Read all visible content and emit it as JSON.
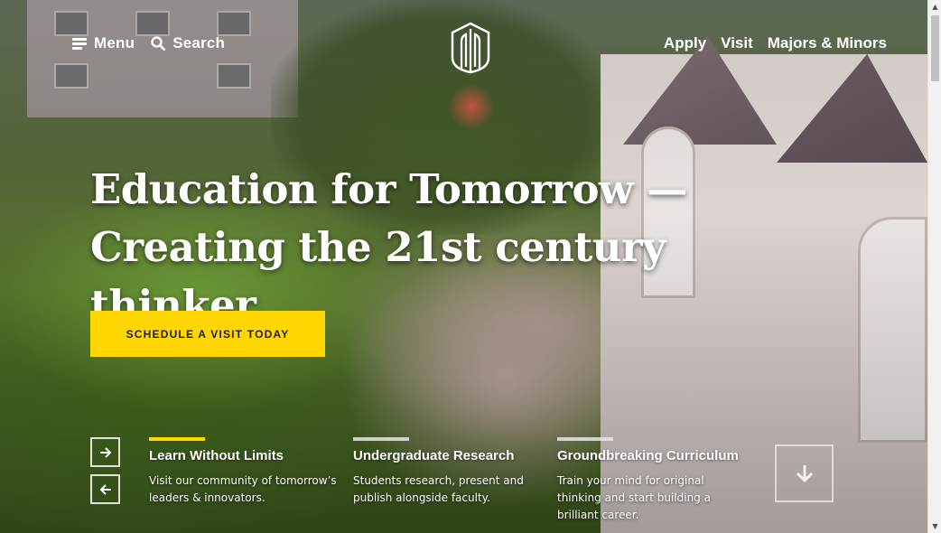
{
  "header": {
    "menu_label": "Menu",
    "search_label": "Search",
    "nav_links": [
      "Apply",
      "Visit",
      "Majors & Minors"
    ]
  },
  "hero": {
    "headline_line1": "Education for Tomorrow —",
    "headline_line2": "Creating the 21st century thinker.",
    "cta_label": "SCHEDULE A VISIT TODAY"
  },
  "features": [
    {
      "title": "Learn Without Limits",
      "text": "Visit our community of tomorrow’s leaders & innovators.",
      "active": true
    },
    {
      "title": "Undergraduate Research",
      "text": "Students research, present and publish alongside faculty.",
      "active": false
    },
    {
      "title": "Groundbreaking Curriculum",
      "text": "Train your mind for original thinking and start building a brilliant career.",
      "active": false
    }
  ],
  "icons": {
    "menu": "menu-icon",
    "search": "search-icon",
    "logo": "logo-icon",
    "next": "arrow-right-icon",
    "prev": "arrow-left-icon",
    "scroll": "arrow-down-icon"
  },
  "colors": {
    "accent": "#ffd600",
    "cta_text": "#1d1d1d"
  }
}
